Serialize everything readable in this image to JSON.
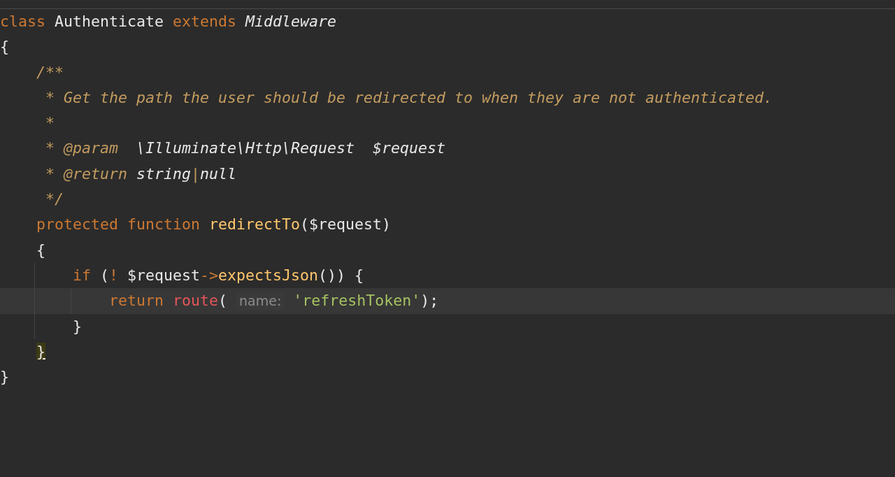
{
  "editor": {
    "lines": [
      {
        "current": false,
        "tokens": [
          {
            "kind": "keyword",
            "text": "class"
          },
          {
            "kind": "plain",
            "text": " Authenticate "
          },
          {
            "kind": "keyword",
            "text": "extends"
          },
          {
            "kind": "type",
            "text": " Middleware"
          }
        ]
      },
      {
        "current": false,
        "tokens": [
          {
            "kind": "plain",
            "text": "{"
          }
        ]
      },
      {
        "current": false,
        "tokens": [
          {
            "kind": "comment",
            "text": "    /**"
          }
        ]
      },
      {
        "current": false,
        "tokens": [
          {
            "kind": "comment",
            "text": "     * Get the path the user should be redirected to when they are not authenticated."
          }
        ]
      },
      {
        "current": false,
        "tokens": [
          {
            "kind": "comment",
            "text": "     *"
          }
        ]
      },
      {
        "current": false,
        "tokens": [
          {
            "kind": "comment",
            "text": "     * @param  "
          },
          {
            "kind": "doctype",
            "text": "\\Illuminate\\Http\\Request  $request"
          }
        ]
      },
      {
        "current": false,
        "tokens": [
          {
            "kind": "comment",
            "text": "     * @return "
          },
          {
            "kind": "doctype",
            "text": "string"
          },
          {
            "kind": "comment",
            "text": "|"
          },
          {
            "kind": "doctype",
            "text": "null"
          }
        ]
      },
      {
        "current": false,
        "tokens": [
          {
            "kind": "comment",
            "text": "     */"
          }
        ]
      },
      {
        "current": false,
        "tokens": [
          {
            "kind": "keyword",
            "text": "    protected function"
          },
          {
            "kind": "function",
            "text": " redirectTo"
          },
          {
            "kind": "plain",
            "text": "($request)"
          }
        ]
      },
      {
        "current": false,
        "tokens": [
          {
            "kind": "plain",
            "text": "    {"
          }
        ]
      },
      {
        "current": false,
        "tokens": [
          {
            "kind": "keyword",
            "text": "        if"
          },
          {
            "kind": "plain",
            "text": " ("
          },
          {
            "kind": "keyword",
            "text": "!"
          },
          {
            "kind": "plain",
            "text": " $request"
          },
          {
            "kind": "keyword",
            "text": "->"
          },
          {
            "kind": "function",
            "text": "expectsJson"
          },
          {
            "kind": "plain",
            "text": "()) {"
          }
        ]
      },
      {
        "current": true,
        "tokens": [
          {
            "kind": "keyword",
            "text": "            return"
          },
          {
            "kind": "call",
            "text": " route"
          },
          {
            "kind": "plain",
            "text": "( "
          },
          {
            "kind": "hint",
            "text": "name:"
          },
          {
            "kind": "string",
            "text": " 'refreshToken'"
          },
          {
            "kind": "plain",
            "text": ");"
          }
        ]
      },
      {
        "current": false,
        "tokens": [
          {
            "kind": "plain",
            "text": "        }"
          }
        ]
      },
      {
        "current": false,
        "tokens": [
          {
            "kind": "match",
            "text": "    }"
          }
        ]
      },
      {
        "current": false,
        "tokens": [
          {
            "kind": "plain",
            "text": "}"
          }
        ]
      }
    ]
  }
}
